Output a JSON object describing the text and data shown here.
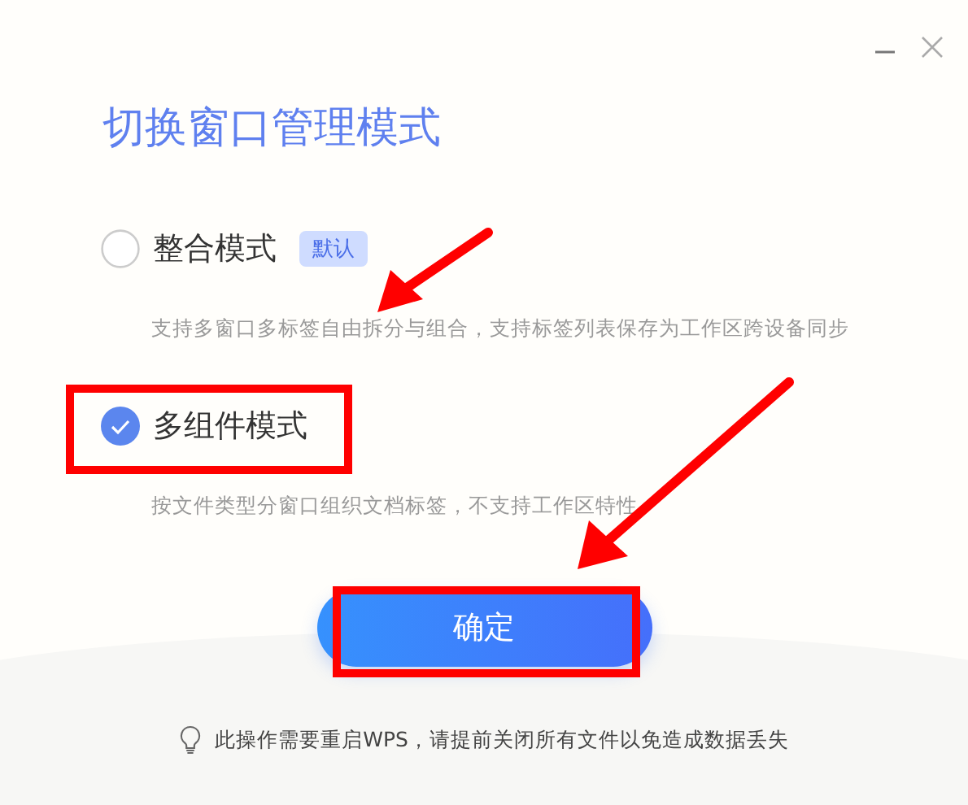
{
  "title": "切换窗口管理模式",
  "options": [
    {
      "label": "整合模式",
      "badge": "默认",
      "description": "支持多窗口多标签自由拆分与组合，支持标签列表保存为工作区跨设备同步",
      "selected": false
    },
    {
      "label": "多组件模式",
      "description": "按文件类型分窗口组织文档标签，不支持工作区特性",
      "selected": true
    }
  ],
  "confirm_button": "确定",
  "notice": "此操作需要重启WPS，请提前关闭所有文件以免造成数据丢失"
}
